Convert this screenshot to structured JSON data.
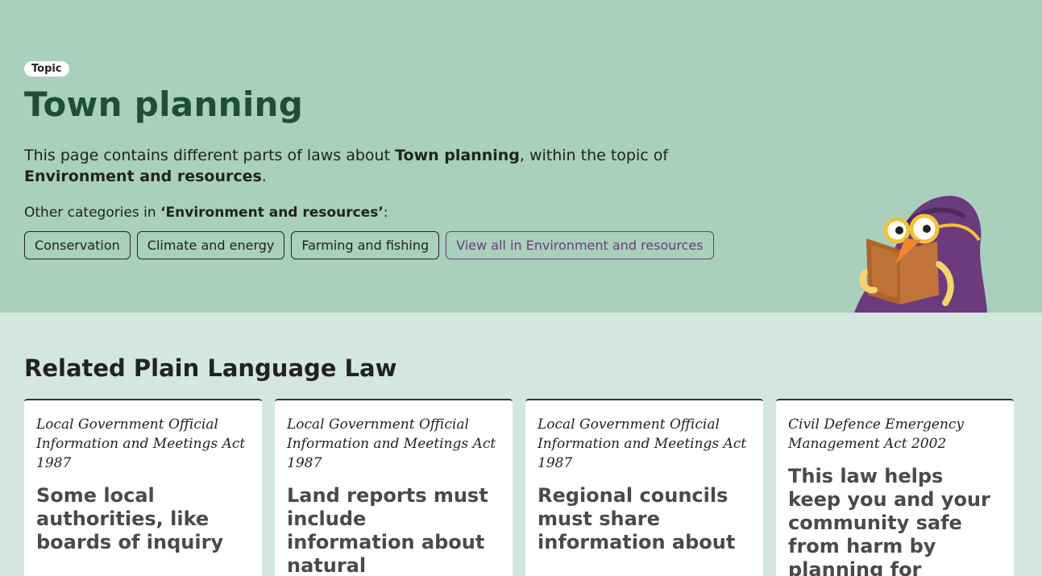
{
  "hero": {
    "badge": "Topic",
    "title": "Town planning",
    "intro_prefix": "This page contains different parts of laws about ",
    "intro_topic": "Town planning",
    "intro_middle": ", within the topic of ",
    "intro_parent": "Environment and resources",
    "intro_suffix": ".",
    "other_prefix": "Other categories in ",
    "other_parent": "‘Environment and resources’",
    "other_suffix": ":",
    "chips": [
      "Conservation",
      "Climate and energy",
      "Farming and fishing"
    ],
    "view_all": "View all in Environment and resources"
  },
  "related": {
    "heading": "Related Plain Language Law",
    "cards": [
      {
        "act": "Local Government Official Information and Meetings Act 1987",
        "headline": "Some local authorities, like boards of inquiry"
      },
      {
        "act": "Local Government Official Information and Meetings Act 1987",
        "headline": "Land reports must include information about natural"
      },
      {
        "act": "Local Government Official Information and Meetings Act 1987",
        "headline": "Regional councils must share information about"
      },
      {
        "act": "Civil Defence Emergency Management Act 2002",
        "headline": "This law helps keep you and your community safe from harm by planning for"
      }
    ]
  },
  "colors": {
    "hero_bg": "#a9cfbd",
    "page_bg": "#d3e7de",
    "title": "#1f4d35",
    "link_purple": "#6a3f7d"
  },
  "icons": {
    "mascot": "reading-bird-illustration"
  }
}
